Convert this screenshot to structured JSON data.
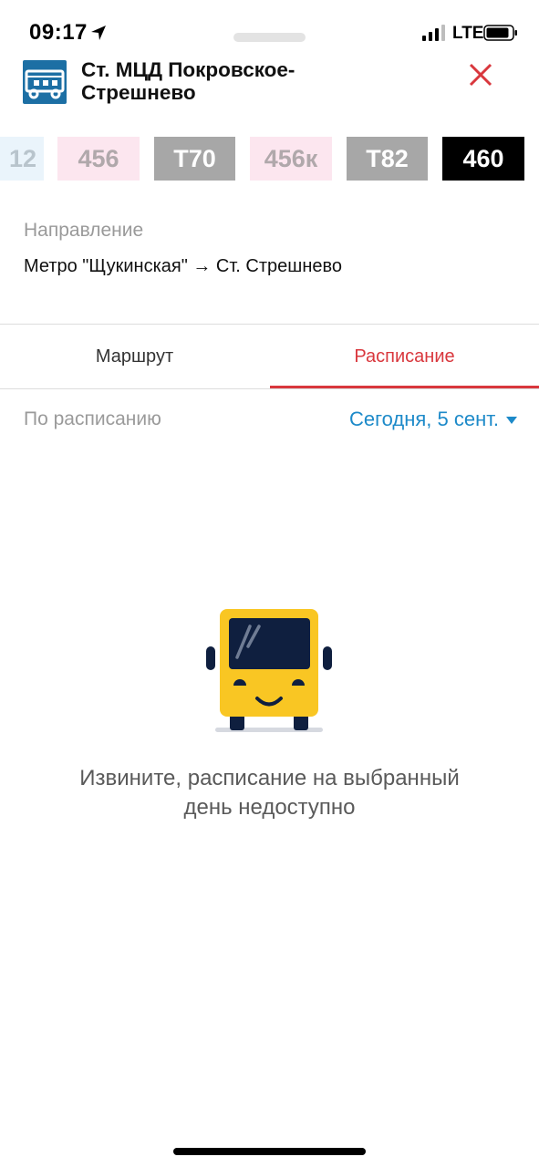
{
  "status_bar": {
    "time": "09:17",
    "network": "LTE"
  },
  "header": {
    "title": "Ст. МЦД Покровское-Стрешнево",
    "icon": "bus-stop-icon",
    "close_icon": "close-icon"
  },
  "routes": [
    {
      "label": "12",
      "style": "partial"
    },
    {
      "label": "456",
      "style": "pink"
    },
    {
      "label": "Т70",
      "style": "grey"
    },
    {
      "label": "456к",
      "style": "pink"
    },
    {
      "label": "Т82",
      "style": "grey"
    },
    {
      "label": "460",
      "style": "black",
      "selected": true
    }
  ],
  "direction": {
    "label": "Направление",
    "value": "Метро \"Щукинская\" → Ст. Стрешнево"
  },
  "tabs": [
    {
      "label": "Маршрут",
      "active": false
    },
    {
      "label": "Расписание",
      "active": true
    }
  ],
  "schedule": {
    "filter_label": "По расписанию",
    "date": "Сегодня, 5 сент."
  },
  "empty_state": {
    "line1": "Извините, расписание на выбранный",
    "line2": "день недоступно",
    "illustration": "bus-illustration"
  },
  "colors": {
    "accent_red": "#d9373d",
    "link_blue": "#1d8ac9",
    "stop_icon_blue": "#1c6fa4",
    "bus_yellow": "#f9c623",
    "bus_navy": "#0f1f3f"
  }
}
